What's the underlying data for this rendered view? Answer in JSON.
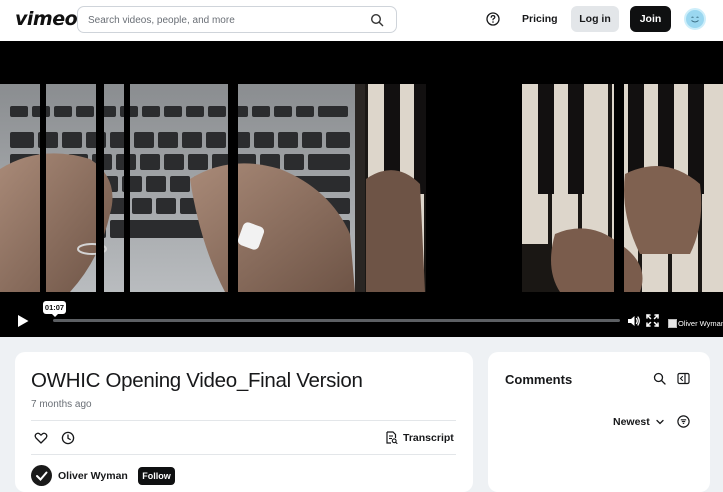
{
  "header": {
    "logo": "vimeo",
    "search_placeholder": "Search videos, people, and more",
    "pricing": "Pricing",
    "login": "Log in",
    "join": "Join"
  },
  "player": {
    "current_time_tooltip": "01:07",
    "brand_alt": "Oliver Wyman",
    "progress_fraction": 0.0
  },
  "video": {
    "title": "OWHIC Opening Video_Final Version",
    "age": "7 months ago",
    "transcript_label": "Transcript",
    "owner_name": "Oliver Wyman",
    "follow_label": "Follow"
  },
  "comments": {
    "title": "Comments",
    "sort_label": "Newest"
  },
  "colors": {
    "accent_dark": "#0f1011",
    "page_bg": "#eef1f4",
    "avatar": "#9ad7f0"
  }
}
